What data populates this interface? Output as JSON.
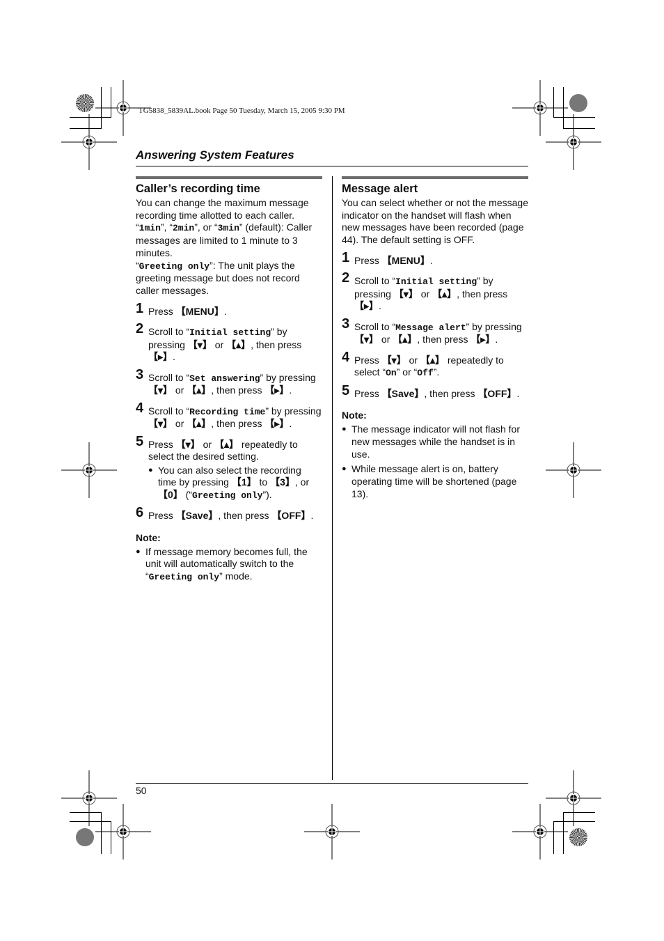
{
  "print_meta": {
    "book_line": "TG5838_5839AL.book  Page 50  Tuesday, March 15, 2005  9:30 PM"
  },
  "header": {
    "section_title": "Answering System Features"
  },
  "left": {
    "title": "Caller’s recording time",
    "intro_1": "You can change the maximum message recording time allotted to each caller.",
    "opt_1min": "1min",
    "opt_2min": "2min",
    "opt_3min": "3min",
    "intro_2_tail": " (default): Caller messages are limited to 1 minute to 3 minutes.",
    "opt_greeting": "Greeting only",
    "intro_3_tail": ": The unit plays the greeting message but does not record caller messages.",
    "steps": [
      {
        "num": "1",
        "text_a": "Press ",
        "key_a": "【MENU】",
        "text_b": "."
      },
      {
        "num": "2",
        "text_a": "Scroll to “",
        "mono": "Initial setting",
        "text_b": "” by pressing ",
        "key_a": "【▾】",
        "text_c": " or ",
        "key_b": "【▴】",
        "text_d": ", then press ",
        "key_c": "【▸】",
        "text_e": "."
      },
      {
        "num": "3",
        "text_a": "Scroll to “",
        "mono": "Set answering",
        "text_b": "” by pressing ",
        "key_a": "【▾】",
        "text_c": " or ",
        "key_b": "【▴】",
        "text_d": ", then press ",
        "key_c": "【▸】",
        "text_e": "."
      },
      {
        "num": "4",
        "text_a": "Scroll to “",
        "mono": "Recording time",
        "text_b": "” by pressing ",
        "key_a": "【▾】",
        "text_c": " or ",
        "key_b": "【▴】",
        "text_d": ", then press ",
        "key_c": "【▸】",
        "text_e": "."
      },
      {
        "num": "5",
        "text_a": "Press ",
        "key_a": "【▾】",
        "text_b": " or ",
        "key_b": "【▴】",
        "text_c": " repeatedly to select the desired setting.",
        "sub_a": "You can also select the recording time by pressing ",
        "sub_key1": "【1】",
        "sub_b": " to ",
        "sub_key2": "【3】",
        "sub_c": ", or ",
        "sub_key3": "【0】",
        "sub_d": " (“",
        "sub_mono": "Greeting only",
        "sub_e": "”)."
      },
      {
        "num": "6",
        "text_a": "Press ",
        "key_a": "【Save】",
        "text_b": ", then press ",
        "key_b": "【OFF】",
        "text_c": "."
      }
    ],
    "note_label": "Note:",
    "note_a": "If message memory becomes full, the unit will automatically switch to the “",
    "note_mono": "Greeting only",
    "note_b": "” mode."
  },
  "right": {
    "title": "Message alert",
    "intro": "You can select whether or not the message indicator on the handset will flash when new messages have been recorded (page 44). The default setting is OFF.",
    "steps": [
      {
        "num": "1",
        "text_a": "Press ",
        "key_a": "【MENU】",
        "text_b": "."
      },
      {
        "num": "2",
        "text_a": "Scroll to “",
        "mono": "Initial setting",
        "text_b": "” by pressing ",
        "key_a": "【▾】",
        "text_c": " or ",
        "key_b": "【▴】",
        "text_d": ", then press ",
        "key_c": "【▸】",
        "text_e": "."
      },
      {
        "num": "3",
        "text_a": "Scroll to “",
        "mono": "Message alert",
        "text_b": "” by pressing ",
        "key_a": "【▾】",
        "text_c": " or ",
        "key_b": "【▴】",
        "text_d": ", then press ",
        "key_c": "【▸】",
        "text_e": "."
      },
      {
        "num": "4",
        "text_a": "Press ",
        "key_a": "【▾】",
        "text_b": " or ",
        "key_b": "【▴】",
        "text_c": " repeatedly to select “",
        "mono_a": "On",
        "text_d": "” or “",
        "mono_b": "Off",
        "text_e": "”."
      },
      {
        "num": "5",
        "text_a": "Press ",
        "key_a": "【Save】",
        "text_b": ", then press ",
        "key_b": "【OFF】",
        "text_c": "."
      }
    ],
    "note_label": "Note:",
    "notes": [
      "The message indicator will not flash for new messages while the handset is in use.",
      "While message alert is on, battery operating time will be shortened (page 13)."
    ]
  },
  "footer": {
    "page_number": "50"
  },
  "icons": {
    "bullet": "●"
  }
}
